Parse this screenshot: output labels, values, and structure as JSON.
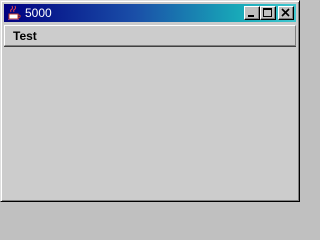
{
  "window": {
    "title": "5000",
    "icon": "java-app-icon",
    "controls": {
      "minimize_icon": "minimize-icon",
      "maximize_icon": "maximize-icon",
      "close_icon": "close-icon"
    }
  },
  "menubar": {
    "items": [
      {
        "label": "Test"
      }
    ]
  },
  "colors": {
    "titlebar_start": "#000080",
    "titlebar_end": "#40c8d0",
    "background": "#cccccc"
  }
}
